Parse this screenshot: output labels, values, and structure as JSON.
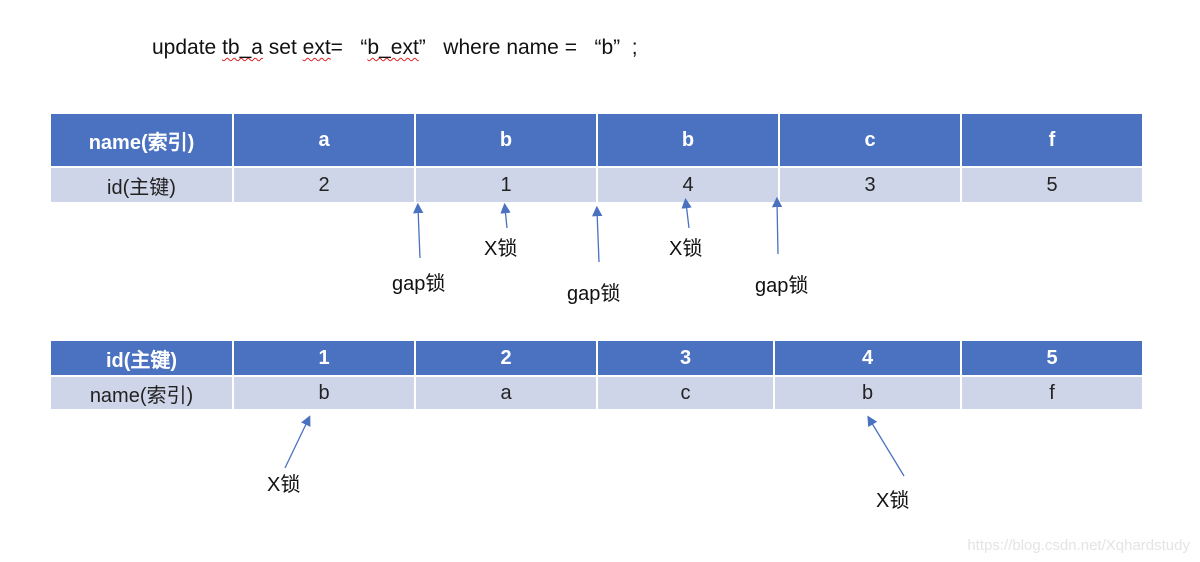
{
  "sql": {
    "prefix": "update ",
    "table": "tb_a",
    "mid1": " set ",
    "col": "ext",
    "mid2": "=   “",
    "val": "b_ext",
    "suffix": "”   where name =   “b”  ;"
  },
  "index_table": {
    "header": [
      "name(索引)",
      "a",
      "b",
      "b",
      "c",
      "f"
    ],
    "row": [
      "id(主键)",
      "2",
      "1",
      "4",
      "3",
      "5"
    ]
  },
  "primary_table": {
    "header": [
      "id(主键)",
      "1",
      "2",
      "3",
      "4",
      "5"
    ],
    "row": [
      "name(索引)",
      "b",
      "a",
      "c",
      "b",
      "f"
    ]
  },
  "annotations": {
    "gap1": "gap锁",
    "x1": "X锁",
    "gap2": "gap锁",
    "x2": "X锁",
    "gap3": "gap锁",
    "x3": "X锁",
    "x4": "X锁"
  },
  "colors": {
    "header_bg": "#4a72c0",
    "row_bg": "#cfd5e8",
    "arrow": "#4a72c0"
  },
  "watermark": "https://blog.csdn.net/Xqhardstudy"
}
